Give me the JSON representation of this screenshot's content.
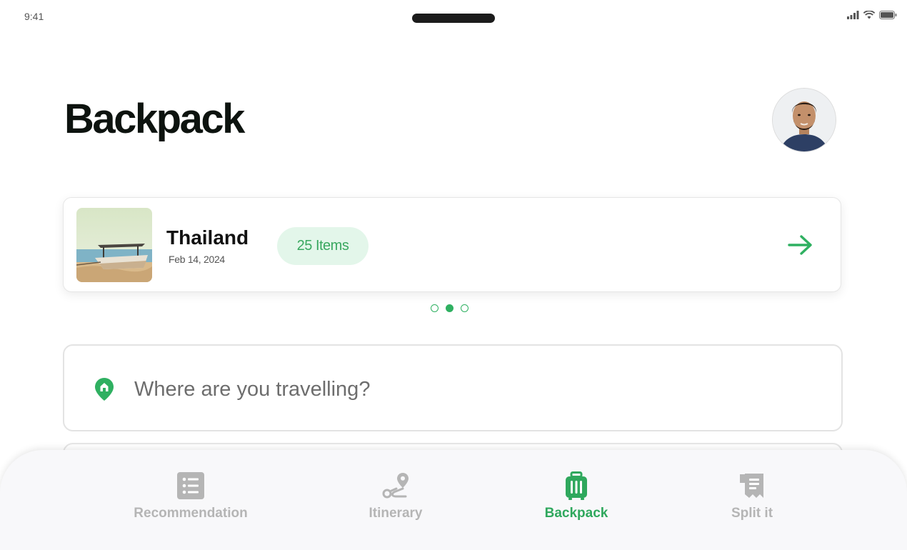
{
  "status": {
    "time": "9:41"
  },
  "header": {
    "title": "Backpack"
  },
  "trip": {
    "name": "Thailand",
    "date": "Feb 14, 2024",
    "items_label": "25 Items"
  },
  "pager": {
    "count": 3,
    "active_index": 1
  },
  "search": {
    "placeholder": "Where are you travelling?"
  },
  "nav": {
    "items": [
      {
        "label": "Recommendation",
        "icon": "list-icon"
      },
      {
        "label": "Itinerary",
        "icon": "route-icon"
      },
      {
        "label": "Backpack",
        "icon": "suitcase-icon",
        "active": true
      },
      {
        "label": "Split it",
        "icon": "receipt-icon"
      }
    ]
  },
  "colors": {
    "accent": "#2fb061",
    "badge_bg": "#e3f6ea",
    "inactive": "#b5b5b5"
  }
}
